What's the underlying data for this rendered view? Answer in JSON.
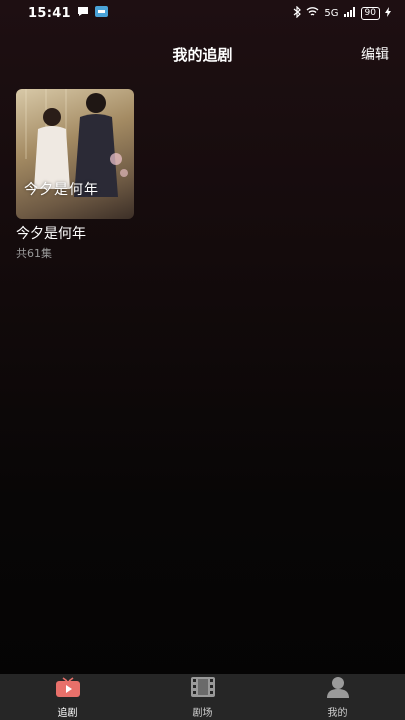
{
  "status_bar": {
    "time": "15:41",
    "icons": [
      "chat-bubble-icon",
      "app-notification-icon",
      "bluetooth-icon",
      "wifi-icon",
      "signal-icon",
      "battery-icon",
      "charging-icon"
    ],
    "network": "5G",
    "battery": "90"
  },
  "header": {
    "title": "我的追剧",
    "edit_label": "编辑"
  },
  "items": [
    {
      "title": "今夕是何年",
      "poster_title": "今夕是何年",
      "episodes": "共61集"
    }
  ],
  "tabbar": {
    "tabs": [
      {
        "label": "追剧",
        "icon": "play-tv-icon",
        "active": true
      },
      {
        "label": "剧场",
        "icon": "film-icon",
        "active": false
      },
      {
        "label": "我的",
        "icon": "user-icon",
        "active": false
      }
    ]
  },
  "colors": {
    "accent": "#e8706a",
    "tabbar_bg": "#262626",
    "background_top": "#1e0f12",
    "background_bottom": "#040404"
  }
}
